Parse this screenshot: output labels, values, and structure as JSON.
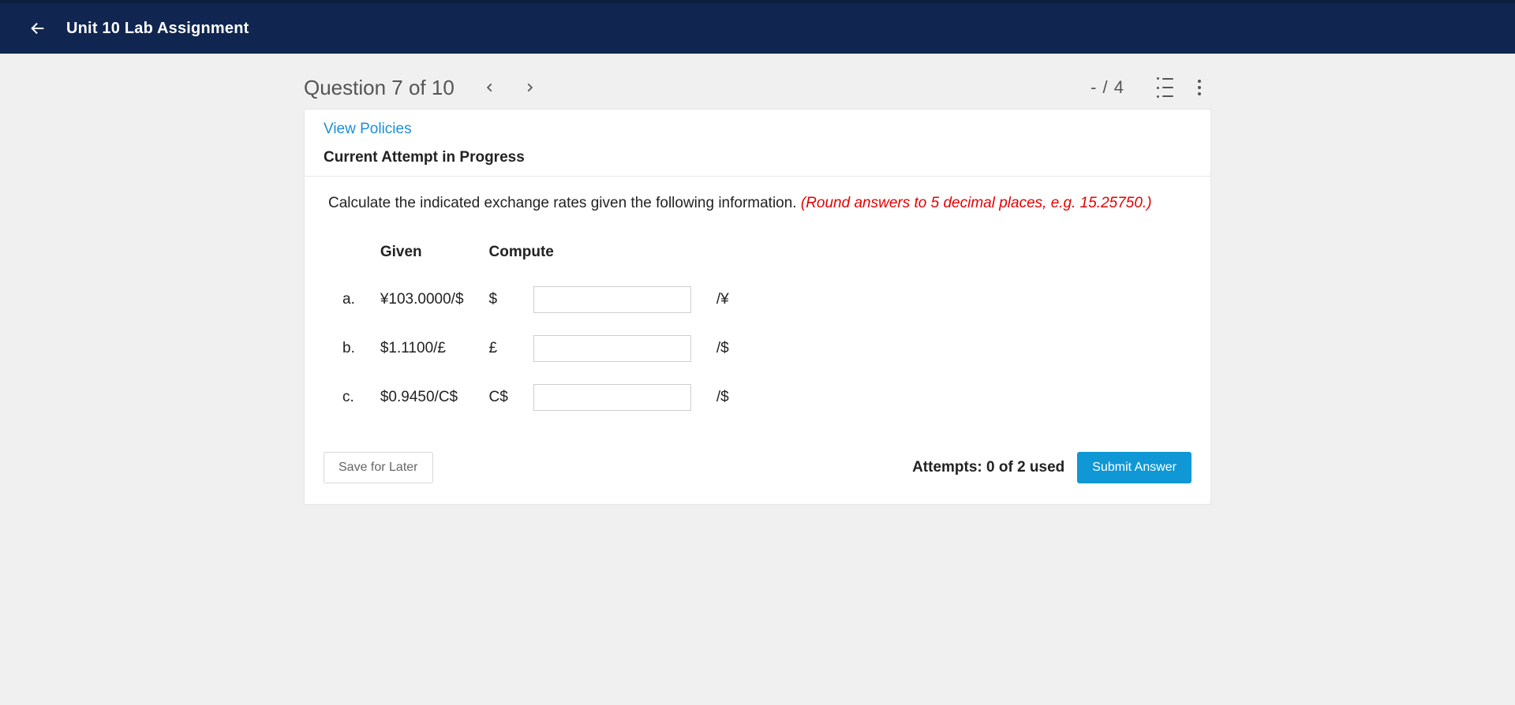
{
  "header": {
    "title": "Unit 10 Lab Assignment"
  },
  "question_bar": {
    "title": "Question 7 of 10",
    "score": "- / 4"
  },
  "card": {
    "policies_link": "View Policies",
    "attempt_label": "Current Attempt in Progress",
    "instruction": "Calculate the indicated exchange rates given the following information. ",
    "hint": "(Round answers to 5 decimal places, e.g. 15.25750.)",
    "table": {
      "col_given": "Given",
      "col_compute": "Compute",
      "rows": [
        {
          "letter": "a.",
          "given": "¥103.0000/$",
          "prefix": "$",
          "value": "",
          "suffix": "/¥"
        },
        {
          "letter": "b.",
          "given": "$1.1100/£",
          "prefix": "£",
          "value": "",
          "suffix": "/$"
        },
        {
          "letter": "c.",
          "given": "$0.9450/C$",
          "prefix": "C$",
          "value": "",
          "suffix": "/$"
        }
      ]
    },
    "save_label": "Save for Later",
    "attempts_text": "Attempts: 0 of 2 used",
    "submit_label": "Submit Answer"
  }
}
